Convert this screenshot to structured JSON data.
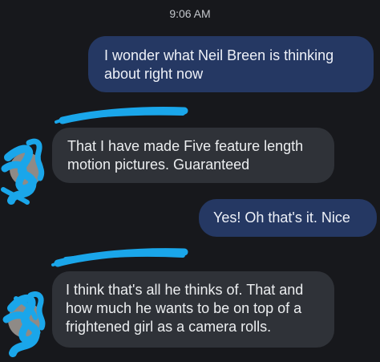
{
  "conversation": {
    "timestamp": "9:06 AM",
    "messages": [
      {
        "direction": "outgoing",
        "text": "I wonder what Neil Breen is thinking about right now"
      },
      {
        "direction": "incoming",
        "text": "That I have made Five feature length motion pictures. Guaranteed"
      },
      {
        "direction": "outgoing",
        "text": "Yes! Oh that's it. Nice"
      },
      {
        "direction": "incoming",
        "text": "I think that's all he thinks of. That and how much he wants to be on top of a frightened girl as a camera rolls."
      }
    ]
  },
  "colors": {
    "background": "#17181c",
    "outgoing_bubble": "#253863",
    "incoming_bubble": "#2f3238",
    "redaction": "#1aa6ea"
  },
  "icons": {
    "sender_avatar": "avatar",
    "redaction_marks": "scribble-redaction"
  }
}
